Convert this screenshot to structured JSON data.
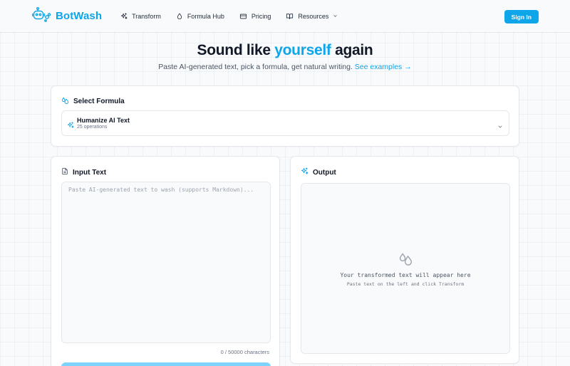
{
  "app": {
    "name": "BotWash",
    "logo_icon": "robot-icon",
    "brand_color": "#0ea5e9"
  },
  "nav": {
    "items": [
      {
        "label": "Transform",
        "icon": "sparkles-icon"
      },
      {
        "label": "Formula Hub",
        "icon": "droplet-icon"
      },
      {
        "label": "Pricing",
        "icon": "credit-card-icon"
      },
      {
        "label": "Resources",
        "icon": "book-icon",
        "has_dropdown": true
      }
    ],
    "signin_label": "Sign In"
  },
  "hero": {
    "title_before": "Sound like ",
    "title_accent": "yourself",
    "title_after": " again",
    "subtitle": "Paste AI-generated text, pick a formula, get natural writing.",
    "link": "See examples →"
  },
  "formula": {
    "title": "Select Formula",
    "selected": {
      "name": "Humanize AI Text",
      "operations": "25 operations"
    }
  },
  "input": {
    "title": "Input Text",
    "value": "",
    "placeholder": "Paste AI-generated text to wash (supports Markdown)...",
    "char_count": "0 / 50000 characters",
    "button_color": "#7dd3fc"
  },
  "output": {
    "title": "Output",
    "empty_message": "Your transformed text will appear here",
    "empty_hint": "Paste text on the left and click Transform"
  }
}
